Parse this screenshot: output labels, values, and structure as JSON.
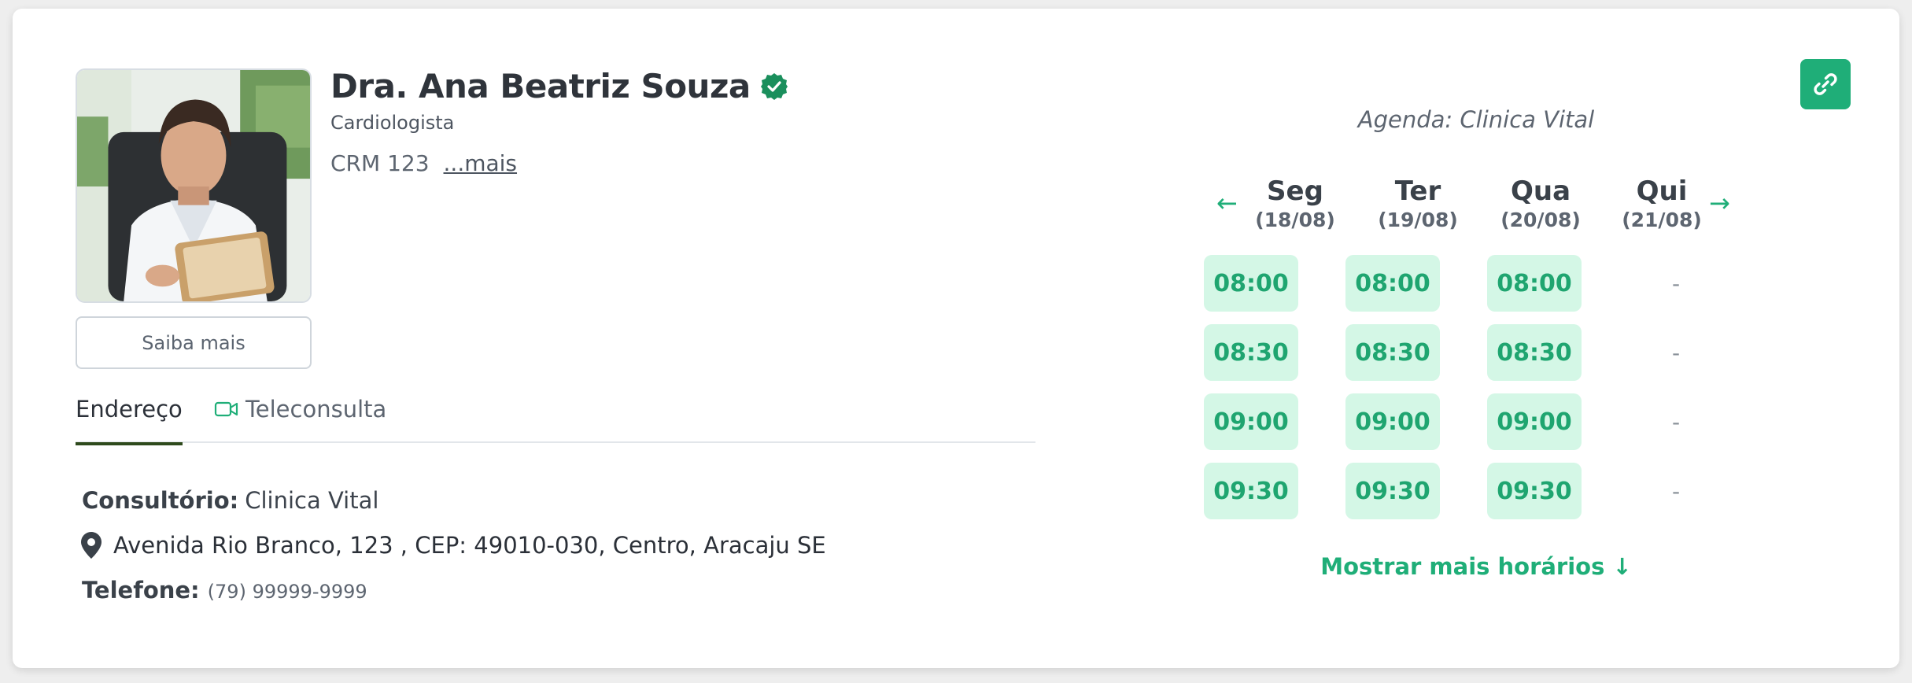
{
  "doctor": {
    "name": "Dra. Ana Beatriz Souza",
    "specialty": "Cardiologista",
    "crm": "CRM 123",
    "more_link": "...mais",
    "learn_more_button": "Saiba mais",
    "verified_icon": "verified-check-icon"
  },
  "tabs": [
    {
      "label": "Endereço",
      "active": true
    },
    {
      "label": "Teleconsulta",
      "active": false,
      "icon": "video-camera-icon"
    }
  ],
  "address": {
    "office_label": "Consultório:",
    "office_value": "Clinica Vital",
    "street": "Avenida Rio Branco, 123 , CEP: 49010-030, Centro, Aracaju SE",
    "phone_label": "Telefone:",
    "phone_value": "(79) 99999-9999"
  },
  "agenda": {
    "title": "Agenda: Clinica Vital",
    "prev_arrow": "←",
    "next_arrow": "→",
    "days": [
      {
        "name": "Seg",
        "date": "(18/08)",
        "slots": [
          "08:00",
          "08:30",
          "09:00",
          "09:30"
        ]
      },
      {
        "name": "Ter",
        "date": "(19/08)",
        "slots": [
          "08:00",
          "08:30",
          "09:00",
          "09:30"
        ]
      },
      {
        "name": "Qua",
        "date": "(20/08)",
        "slots": [
          "08:00",
          "08:30",
          "09:00",
          "09:30"
        ]
      },
      {
        "name": "Qui",
        "date": "(21/08)",
        "slots": [
          "-",
          "-",
          "-",
          "-"
        ]
      }
    ],
    "more_times": "Mostrar mais horários ↓"
  },
  "colors": {
    "accent": "#1fae78",
    "slot_bg": "#d4f7e6",
    "tab_indicator": "#2e4a1c"
  },
  "icons": {
    "share_link": "link-icon",
    "location": "map-pin-icon"
  }
}
